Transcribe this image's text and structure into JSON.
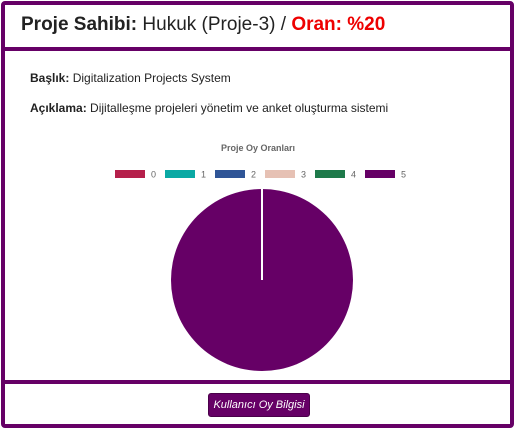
{
  "header": {
    "owner_label": "Proje Sahibi:",
    "owner_value": "Hukuk (Proje-3)",
    "separator": "/",
    "ratio_label": "Oran: %20",
    "ratio_color": "#ee0000",
    "border_color": "#660066"
  },
  "details": {
    "title_label": "Başlık:",
    "title_value": "Digitalization Projects System",
    "desc_label": "Açıklama:",
    "desc_value": "Dijitalleşme projeleri yönetim ve anket oluşturma sistemi"
  },
  "chart_data": {
    "type": "pie",
    "title": "Proje Oy Oranları",
    "legend_position": "top",
    "categories": [
      "0",
      "1",
      "2",
      "3",
      "4",
      "5"
    ],
    "values": [
      0,
      0,
      0,
      0,
      0,
      1
    ],
    "colors": [
      "#b5204b",
      "#0aa9a4",
      "#2f5597",
      "#e6c1b4",
      "#1e7a4a",
      "#660066"
    ]
  },
  "footer": {
    "button_label": "Kullanıcı Oy Bilgisi"
  }
}
